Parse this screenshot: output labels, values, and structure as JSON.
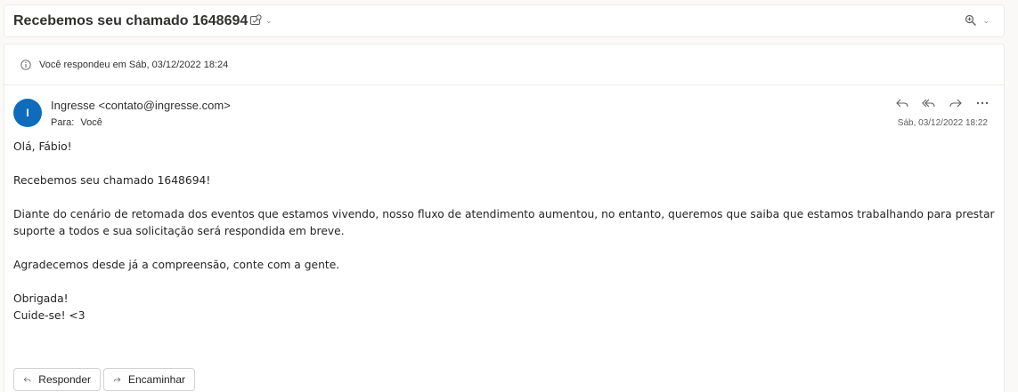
{
  "subject": {
    "title": "Recebemos seu chamado 1648694",
    "tag_icon": "tag-icon",
    "zoom_icon": "zoom-icon"
  },
  "replied": {
    "icon": "info-icon",
    "text": "Você respondeu em Sáb, 03/12/2022 18:24"
  },
  "sender": {
    "initial": "I",
    "display": "Ingresse <contato@ingresse.com>",
    "to_label": "Para:",
    "to_value": "Você",
    "timestamp": "Sáb, 03/12/2022 18:22",
    "avatar_color": "#0f6cbd"
  },
  "actions": [
    "reply-icon",
    "reply-all-icon",
    "forward-icon",
    "more-icon"
  ],
  "body": {
    "greeting": "Olá, Fábio!",
    "line1": "Recebemos seu chamado 1648694!",
    "paragraph": "Diante do cenário de retomada dos eventos que estamos vivendo, nosso fluxo de atendimento aumentou, no entanto, queremos que saiba que estamos trabalhando para prestar suporte a todos e sua solicitação será respondida em breve.",
    "thanks": "Agradecemos desde já a compreensão, conte com a gente.",
    "signoff1": "Obrigada!",
    "signoff2": "Cuide-se! <3"
  },
  "buttons": {
    "reply": "Responder",
    "forward": "Encaminhar"
  }
}
